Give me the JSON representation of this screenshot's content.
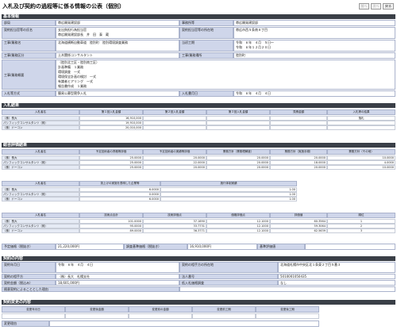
{
  "page": {
    "title": "入札及び契約の過程等に係る情報の公表（個別）",
    "buttons": [
      "前へ",
      "次へ",
      "戻る"
    ]
  },
  "basic": {
    "header": "基本情報",
    "r1": [
      "部局",
      "帯広開発建設部",
      "事務所等",
      "帯広開発建設部"
    ],
    "r2": [
      "契約担当官等の氏名",
      "支出負担行為担当官\n帯広開発建設部長　井　田　泰　蔵",
      "契約担当官等の所在地",
      "帯広市西５条南８丁目"
    ],
    "r3": [
      "工事/業務名",
      "北海道横断自動車道　陸別町　陸別環境調査業務",
      "当初工期",
      "令和　６年　４月　５日～\n令和　６年１２月２０日"
    ],
    "r4": [
      "工事/業務区分",
      "土木関係コンサルタント",
      "工事/業務場所",
      "陸別町"
    ],
    "r5": [
      "工事/業務概要",
      "（陸別北工区・陸別南工区）\n計画準備　１業務\n環境調査　一式\n環境保全計画の検討　一式\n有識者ヒアリング　一式\n報告書作成　１業務"
    ],
    "r6": [
      "入札等方式",
      "簡易公募型競争入札",
      "入札書月日",
      "令和　６年　４月　４日"
    ]
  },
  "bid": {
    "header": "入札結果",
    "cols": [
      "入札者名",
      "第１回入札金額",
      "第２回入札金額",
      "第３回入札金額",
      "見積金額",
      "入札等の結果"
    ],
    "rows": [
      [
        "（株）長大",
        "16,910,000",
        "",
        "",
        "",
        "落札"
      ],
      [
        "パシフィックコンサルタンツ（株）",
        "19,910,000",
        "",
        "",
        "",
        ""
      ],
      [
        "（株）ドーコン",
        "20,010,000",
        "",
        "",
        "",
        ""
      ]
    ]
  },
  "score": {
    "header": "総合評価結果",
    "t1cols": [
      "入札者名",
      "予定技術者の資格等評価",
      "予定技術者の実績等評価",
      "業務方針（業務理解度）",
      "業務方針（実施手順）",
      "業務方針（その他）"
    ],
    "t1rows": [
      [
        "（株）長大",
        "25.0000",
        "20.0000",
        "20.0000",
        "20.0000",
        "10.0000"
      ],
      [
        "パシフィックコンサルタンツ（株）",
        "25.0000",
        "22.0000",
        "20.0000",
        "18.0000",
        "4.0000"
      ],
      [
        "（株）ドーコン",
        "25.0000",
        "20.0000",
        "20.0000",
        "20.0000",
        "10.0000"
      ]
    ],
    "t2cols": [
      "入札者名",
      "賃上げの実施を表明した企業等",
      "施行体制実績"
    ],
    "t2rows": [
      [
        "（株）長大",
        "6.0000",
        "1.00"
      ],
      [
        "パシフィックコンサルタンツ（株）",
        "0.0000",
        "1.00"
      ],
      [
        "（株）ドーコン",
        "6.0000",
        "1.00"
      ]
    ],
    "t3cols": [
      "入札者名",
      "技術点合計",
      "技術評価点",
      "価格評価点",
      "評価値",
      "順位"
    ],
    "t3rows": [
      [
        "（株）長大",
        "101.0000",
        "37.1690",
        "12.1000",
        "60.3564",
        "1"
      ],
      [
        "パシフィックコンサルタンツ（株）",
        "95.0000",
        "33.7731",
        "12.1000",
        "59.3064",
        "2"
      ],
      [
        "（株）ドーコン",
        "89.0000",
        "36.3771",
        "12.1000",
        "62.5639",
        "3"
      ]
    ]
  },
  "price": [
    "予定価格（税抜き）",
    "21,220,000円",
    "調査基準価格（税抜き）",
    "16,910,000円",
    "基準評価値",
    ""
  ],
  "contract": {
    "header": "契約の内容",
    "r1": [
      "契約年月日",
      "令和　６年　４月　４日",
      "契約の相手方の所在地",
      "北海道札幌市中央区北１条東２丁目５番３"
    ],
    "r2": [
      "契約の相手方",
      "（株）長大　札幌支社",
      "法人番号",
      "5010001050435"
    ],
    "r3": [
      "契約金額（税込み）",
      "18,601,000円",
      "低入札価格調査",
      "なし"
    ],
    "r4": [
      "随意契約によることとした理由",
      ""
    ]
  },
  "change": {
    "header": "契約変更の内容",
    "cols": [
      "変更年月日",
      "変更後金額",
      "変更前の金額",
      "変更前工期",
      "変更後工期"
    ],
    "reason": "変更理由"
  }
}
